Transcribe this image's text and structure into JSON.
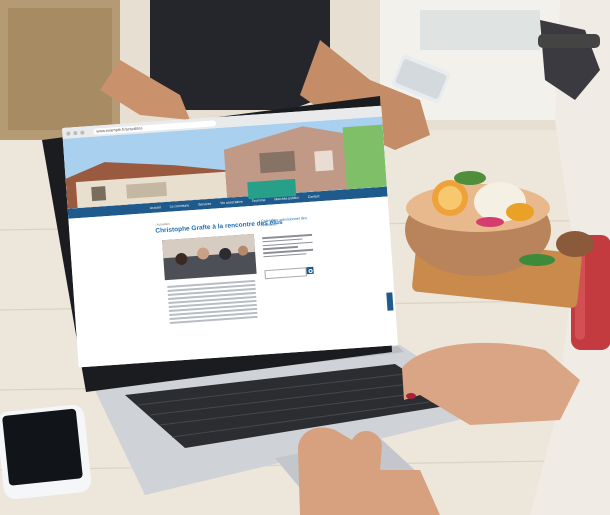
{
  "scene": {
    "description_free": true
  },
  "browser": {
    "url": "www.example.fr/actualites"
  },
  "website": {
    "nav": [
      "Accueil",
      "La commune",
      "Services",
      "Vie associative",
      "Tourisme",
      "Marchés publics",
      "Contact"
    ],
    "breadcrumb": "› Actualités",
    "post_title": "Christophe Grafte à la rencontre des élus",
    "sidebar_title": "Calendrier prévisionnel des réunions"
  },
  "colors": {
    "table": "#e7e0d4",
    "laptop_body": "#c9ccd1",
    "site_nav": "#1f5a8c",
    "accent_badge": "#27a08a"
  },
  "icons": [
    "search-icon"
  ]
}
